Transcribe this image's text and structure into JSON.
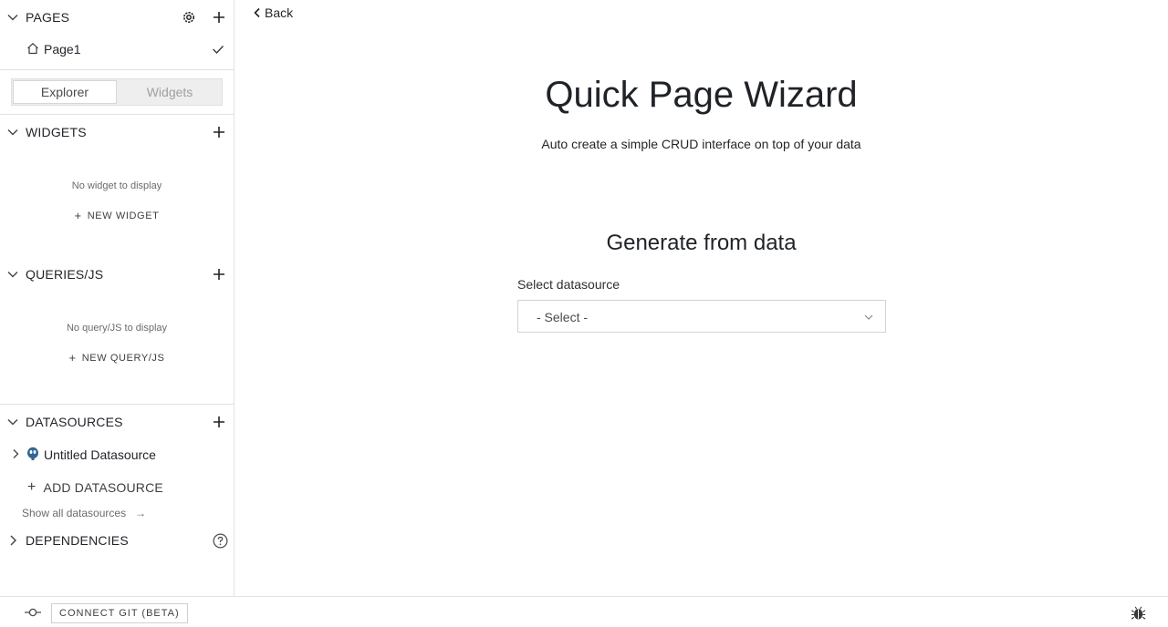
{
  "sidebar": {
    "pages": {
      "title": "PAGES",
      "items": [
        {
          "label": "Page1"
        }
      ]
    },
    "tabs": {
      "explorer": "Explorer",
      "widgets": "Widgets"
    },
    "widgets": {
      "title": "WIDGETS",
      "empty": "No widget to display",
      "new_label": "NEW WIDGET"
    },
    "queries": {
      "title": "QUERIES/JS",
      "empty": "No query/JS to display",
      "new_label": "NEW QUERY/JS"
    },
    "datasources": {
      "title": "DATASOURCES",
      "items": [
        {
          "label": "Untitled Datasource",
          "icon": "postgres-icon"
        }
      ],
      "add_label": "ADD DATASOURCE",
      "show_all_label": "Show all datasources"
    },
    "dependencies": {
      "title": "DEPENDENCIES"
    }
  },
  "bottombar": {
    "git_label": "CONNECT GIT (BETA)"
  },
  "main": {
    "back_label": "Back",
    "title": "Quick Page Wizard",
    "subtitle": "Auto create a simple CRUD interface on top of your data",
    "generate_title": "Generate from data",
    "datasource_label": "Select datasource",
    "select_value": "- Select -"
  }
}
